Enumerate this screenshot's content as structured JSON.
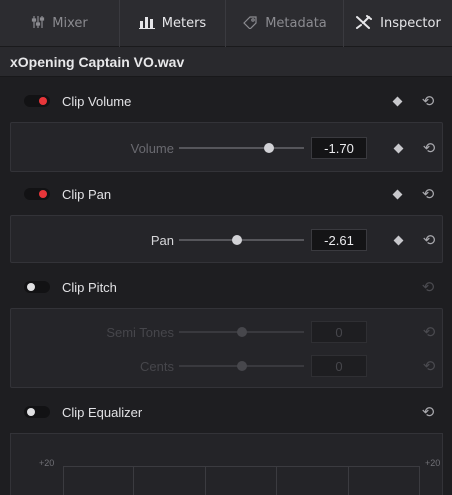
{
  "tabs": [
    {
      "label": "Mixer",
      "icon": "mixer-icon",
      "active": false
    },
    {
      "label": "Meters",
      "icon": "meters-icon",
      "active": true
    },
    {
      "label": "Metadata",
      "icon": "metadata-icon",
      "active": false
    },
    {
      "label": "Inspector",
      "icon": "inspector-icon",
      "active": true
    }
  ],
  "clip_title": "xOpening Captain VO.wav",
  "sections": {
    "volume": {
      "label": "Clip Volume",
      "enabled": true,
      "param_label": "Volume",
      "param_value": "-1.70",
      "slider_fraction": 0.72
    },
    "pan": {
      "label": "Clip Pan",
      "enabled": true,
      "param_label": "Pan",
      "param_value": "-2.61",
      "slider_fraction": 0.46
    },
    "pitch": {
      "label": "Clip Pitch",
      "enabled": false,
      "rows": [
        {
          "param_label": "Semi Tones",
          "param_value": "0",
          "slider_fraction": 0.5
        },
        {
          "param_label": "Cents",
          "param_value": "0",
          "slider_fraction": 0.5
        }
      ]
    },
    "equalizer": {
      "label": "Clip Equalizer",
      "enabled": false,
      "db_left": "+20",
      "db_right": "+20"
    }
  },
  "colors": {
    "toggle_on": "#e8363a",
    "background": "#1e1e21",
    "panel": "#252529"
  }
}
